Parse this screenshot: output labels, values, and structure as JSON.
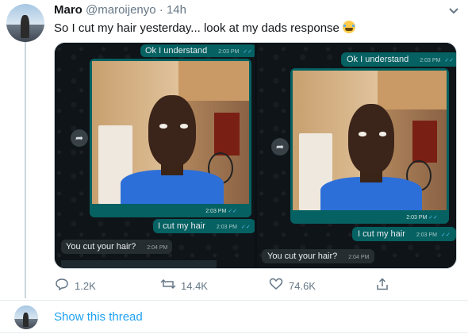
{
  "tweet": {
    "author_name": "Maro",
    "author_handle": "@maroijenyo",
    "separator": "·",
    "time": "14h",
    "text": "So I cut my hair yesterday... look at my dads response",
    "emoji_name": "loudly-crying-face",
    "more_icon": "chevron-down-icon"
  },
  "media": {
    "left": {
      "msg_ok": "Ok I understand",
      "msg_ok_time": "2:03 PM",
      "photo_time": "2:03 PM",
      "msg_cut": "I cut my hair",
      "msg_cut_time": "2:03 PM",
      "msg_reply": "You cut your hair?",
      "msg_reply_time": "2:04 PM"
    },
    "right": {
      "msg_ok": "Ok I understand",
      "msg_ok_time": "2:03 PM",
      "photo_time": "2:03 PM",
      "msg_cut": "I cut my hair",
      "msg_cut_time": "2:03 PM",
      "msg_reply": "You cut your hair?",
      "msg_reply_time": "2:04 PM"
    },
    "checks": "✓✓",
    "forward_icon": "forward-arrow-icon"
  },
  "actions": {
    "replies": "1.2K",
    "retweets": "14.4K",
    "likes": "74.6K",
    "icons": [
      "reply-icon",
      "retweet-icon",
      "like-icon",
      "share-icon"
    ]
  },
  "thread": {
    "show_label": "Show this thread"
  },
  "colors": {
    "accent": "#1da1f2",
    "whatsapp_out": "#056162",
    "whatsapp_in": "#262d31"
  }
}
